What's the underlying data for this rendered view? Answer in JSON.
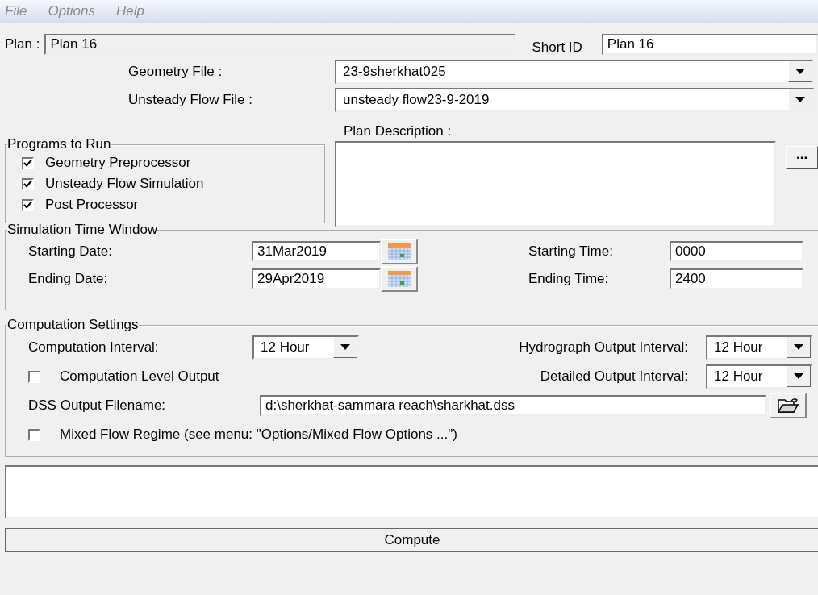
{
  "menu": [
    "File",
    "Options",
    "Help"
  ],
  "plan": {
    "label": "Plan :",
    "value": "Plan 16"
  },
  "short_id": {
    "label": "Short ID",
    "value": "Plan 16"
  },
  "geometry_file": {
    "label": "Geometry File :",
    "value": "23-9sherkhat025"
  },
  "unsteady_flow_file": {
    "label": "Unsteady Flow File :",
    "value": "unsteady flow23-9-2019"
  },
  "plan_description": {
    "label": "Plan Description :",
    "button": "..."
  },
  "programs_to_run": {
    "title": "Programs to Run",
    "items": [
      {
        "label": "Geometry Preprocessor",
        "checked": true
      },
      {
        "label": "Unsteady Flow Simulation",
        "checked": true
      },
      {
        "label": "Post Processor",
        "checked": true
      }
    ]
  },
  "simulation_time_window": {
    "title": "Simulation Time Window",
    "rows": [
      {
        "date_label": "Starting Date:",
        "date": "31Mar2019",
        "time_label": "Starting Time:",
        "time": "0000"
      },
      {
        "date_label": "Ending Date:",
        "date": "29Apr2019",
        "time_label": "Ending Time:",
        "time": "2400"
      }
    ]
  },
  "computation_settings": {
    "title": "Computation Settings",
    "computation_interval": {
      "label": "Computation Interval:",
      "value": "12 Hour"
    },
    "hydrograph_output_interval": {
      "label": "Hydrograph Output Interval:",
      "value": "12 Hour"
    },
    "computation_level_output": {
      "label": "Computation Level Output",
      "checked": false
    },
    "detailed_output_interval": {
      "label": "Detailed Output Interval:",
      "value": "12 Hour"
    },
    "dss_output_filename": {
      "label": "DSS Output Filename:",
      "value": "d:\\sherkhat-sammara reach\\sharkhat.dss"
    },
    "mixed_flow_regime": {
      "label": "Mixed Flow Regime (see menu: \"Options/Mixed Flow Options ...\")",
      "checked": false
    }
  },
  "compute_button": "Compute"
}
